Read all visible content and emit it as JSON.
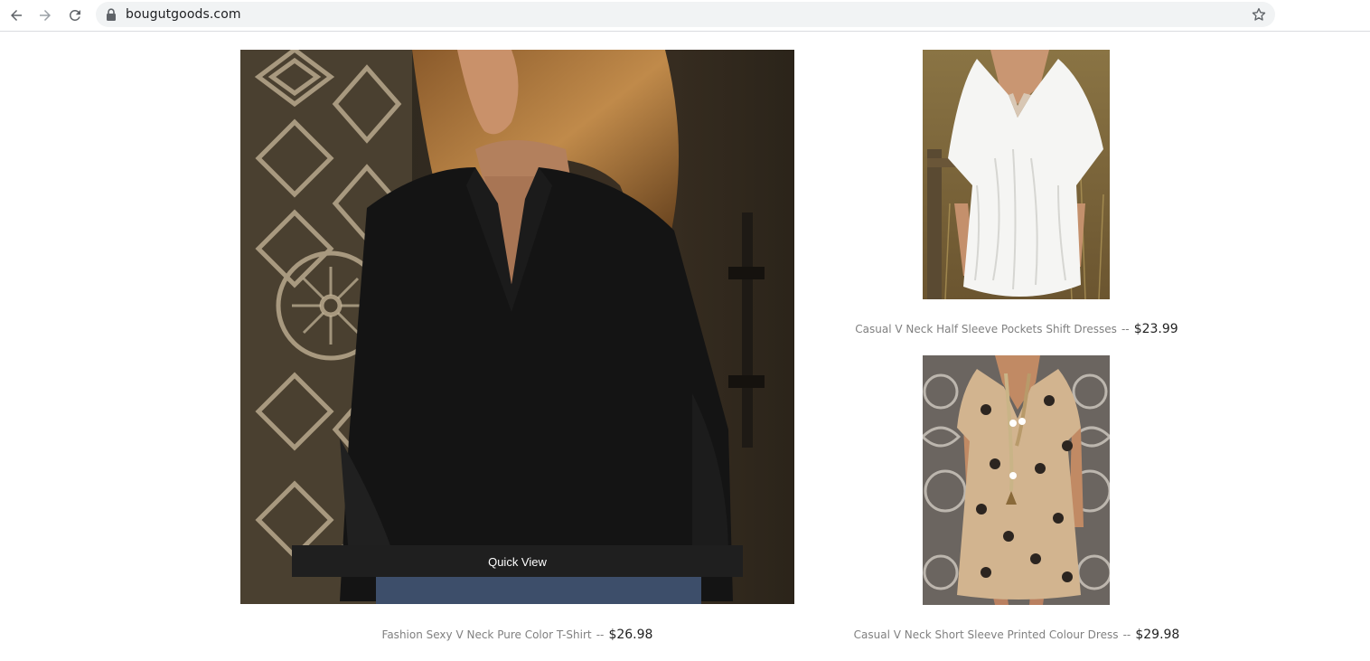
{
  "browser": {
    "url": "bougutgoods.com",
    "icons": [
      "back-arrow-icon",
      "forward-arrow-icon",
      "reload-icon",
      "lock-icon",
      "star-icon"
    ]
  },
  "products": [
    {
      "name": "Fashion Sexy V Neck Pure Color T-Shirt",
      "separator": "--",
      "price": "$26.98",
      "quick_view_label": "Quick View"
    },
    {
      "name": "Casual V Neck Half Sleeve Pockets Shift Dresses",
      "separator": "--",
      "price": "$23.99"
    },
    {
      "name": "Casual V Neck Short Sleeve Printed Colour Dress",
      "separator": "--",
      "price": "$29.98"
    }
  ],
  "colors": {
    "quick_view_bg": "#1f1f1f",
    "caption_name": "#808080",
    "caption_price": "#222222",
    "omnibox_bg": "#f1f3f4"
  }
}
